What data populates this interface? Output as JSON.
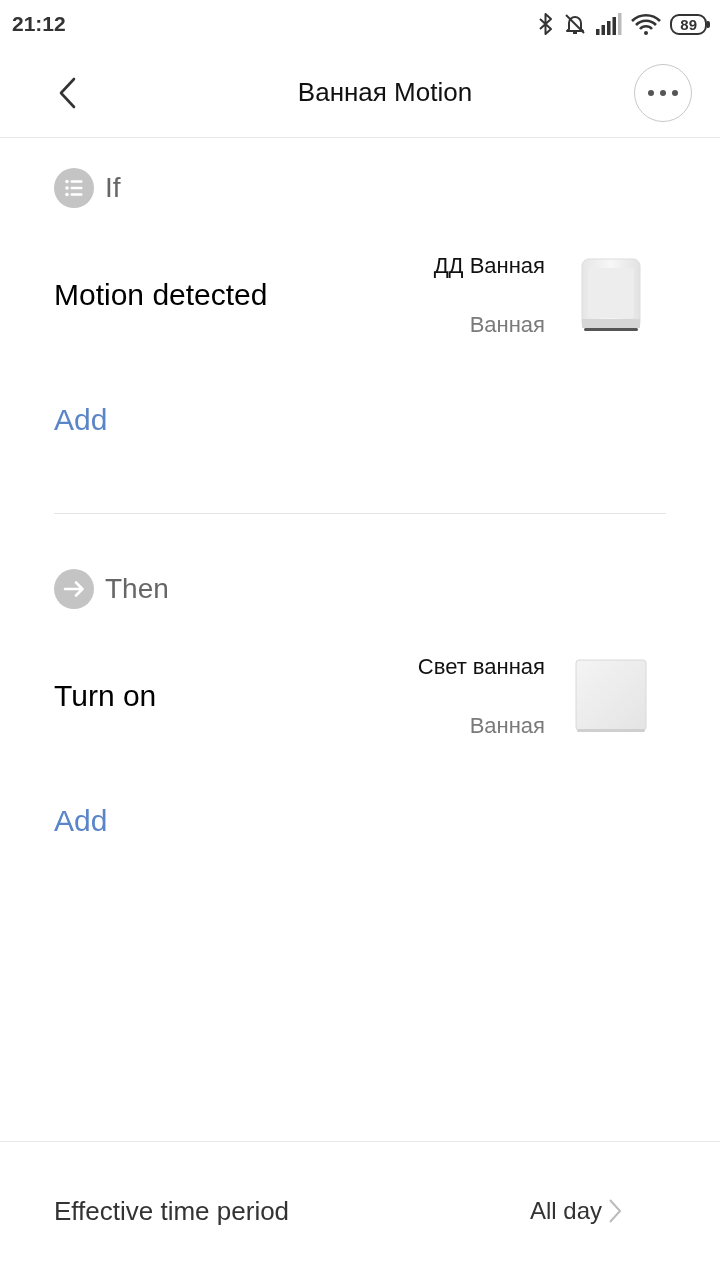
{
  "status_bar": {
    "time": "21:12",
    "battery": "89"
  },
  "header": {
    "title": "Ванная Motion"
  },
  "sections": [
    {
      "kind": "if",
      "heading": "If",
      "items": [
        {
          "kind": "motion_sensor",
          "action": "Motion detected",
          "device": "ДД Ванная",
          "room": "Ванная"
        }
      ],
      "add_label": "Add"
    },
    {
      "kind": "then",
      "heading": "Then",
      "items": [
        {
          "kind": "switch",
          "action": "Turn on",
          "device": "Свет ванная",
          "room": "Ванная"
        }
      ],
      "add_label": "Add"
    }
  ],
  "footer": {
    "label": "Effective time period",
    "value": "All day"
  }
}
